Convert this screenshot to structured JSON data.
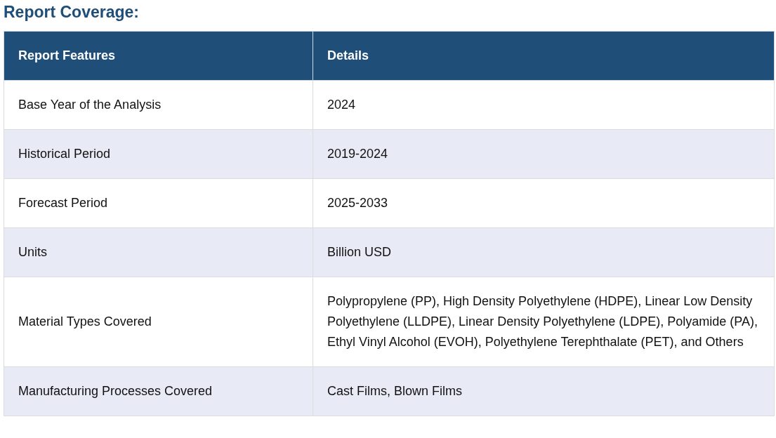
{
  "heading": "Report Coverage:",
  "table": {
    "columns": [
      "Report Features",
      "Details"
    ],
    "rows": [
      [
        "Base Year of the Analysis",
        "2024"
      ],
      [
        "Historical Period",
        "2019-2024"
      ],
      [
        "Forecast Period",
        "2025-2033"
      ],
      [
        "Units",
        "Billion USD"
      ],
      [
        "Material Types Covered",
        "Polypropylene (PP), High Density Polyethylene (HDPE), Linear Low Density Polyethylene (LLDPE), Linear Density Polyethylene (LDPE), Polyamide (PA), Ethyl Vinyl Alcohol (EVOH), Polyethylene Terephthalate (PET), and Others"
      ],
      [
        "Manufacturing Processes Covered",
        "Cast Films, Blown Films"
      ]
    ]
  }
}
